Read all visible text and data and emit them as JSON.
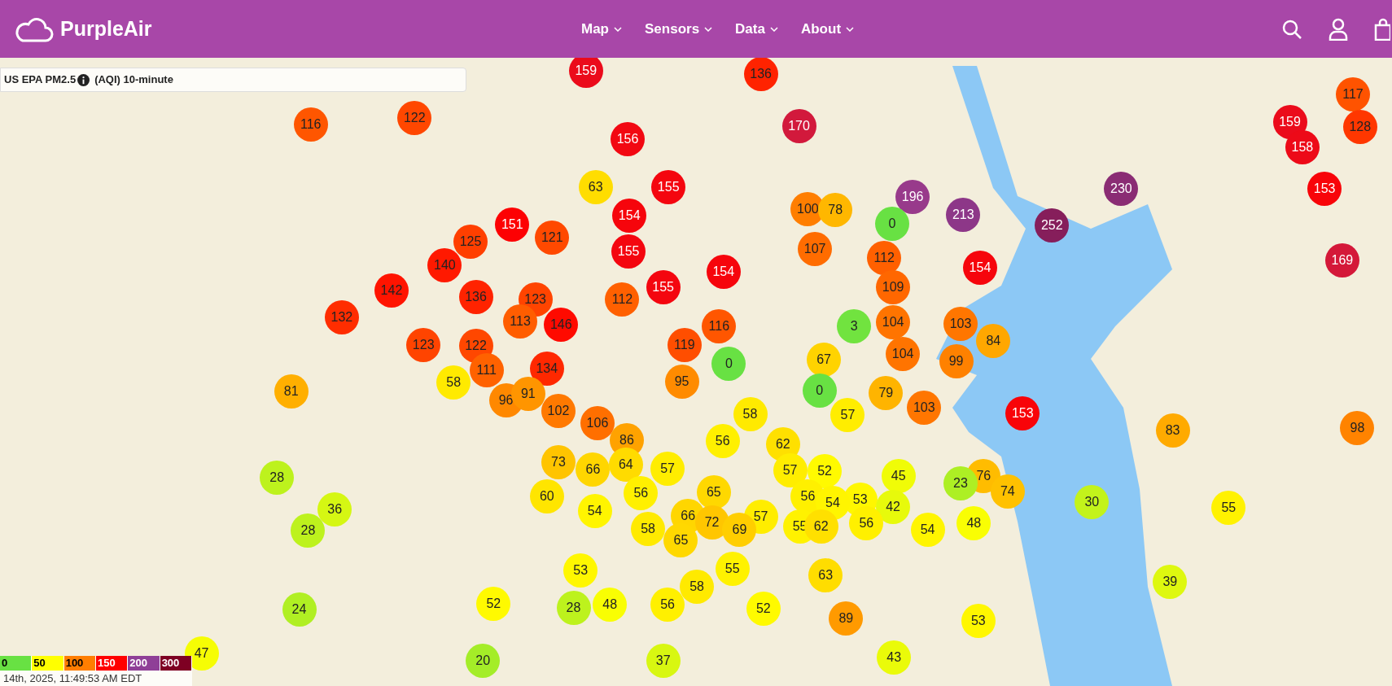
{
  "header": {
    "brand": "PurpleAir",
    "nav": [
      {
        "label": "Map"
      },
      {
        "label": "Sensors"
      },
      {
        "label": "Data"
      },
      {
        "label": "About"
      }
    ]
  },
  "map_layer": {
    "label": "US EPA PM2.5",
    "suffix": "(AQI) 10-minute"
  },
  "markers": [
    {
      "value": "159"
    },
    {
      "value": "136"
    },
    {
      "value": "117"
    },
    {
      "value": "116"
    },
    {
      "value": "122"
    },
    {
      "value": "156"
    },
    {
      "value": "170"
    },
    {
      "value": "159"
    },
    {
      "value": "158"
    },
    {
      "value": "128"
    },
    {
      "value": "63"
    },
    {
      "value": "155"
    },
    {
      "value": "196"
    },
    {
      "value": "230"
    },
    {
      "value": "153"
    },
    {
      "value": "151"
    },
    {
      "value": "154"
    },
    {
      "value": "100"
    },
    {
      "value": "78"
    },
    {
      "value": "0"
    },
    {
      "value": "213"
    },
    {
      "value": "252"
    },
    {
      "value": "125"
    },
    {
      "value": "121"
    },
    {
      "value": "155"
    },
    {
      "value": "107"
    },
    {
      "value": "140"
    },
    {
      "value": "154"
    },
    {
      "value": "112"
    },
    {
      "value": "154"
    },
    {
      "value": "169"
    },
    {
      "value": "142"
    },
    {
      "value": "136"
    },
    {
      "value": "123"
    },
    {
      "value": "112"
    },
    {
      "value": "155"
    },
    {
      "value": "109"
    },
    {
      "value": "132"
    },
    {
      "value": "113"
    },
    {
      "value": "146"
    },
    {
      "value": "116"
    },
    {
      "value": "3"
    },
    {
      "value": "104"
    },
    {
      "value": "103"
    },
    {
      "value": "123"
    },
    {
      "value": "122"
    },
    {
      "value": "119"
    },
    {
      "value": "104"
    },
    {
      "value": "84"
    },
    {
      "value": "111"
    },
    {
      "value": "134"
    },
    {
      "value": "0"
    },
    {
      "value": "67"
    },
    {
      "value": "99"
    },
    {
      "value": "81"
    },
    {
      "value": "58"
    },
    {
      "value": "96"
    },
    {
      "value": "91"
    },
    {
      "value": "102"
    },
    {
      "value": "106"
    },
    {
      "value": "86"
    },
    {
      "value": "95"
    },
    {
      "value": "56"
    },
    {
      "value": "58"
    },
    {
      "value": "0"
    },
    {
      "value": "57"
    },
    {
      "value": "79"
    },
    {
      "value": "103"
    },
    {
      "value": "153"
    },
    {
      "value": "83"
    },
    {
      "value": "98"
    },
    {
      "value": "73"
    },
    {
      "value": "62"
    },
    {
      "value": "28"
    },
    {
      "value": "66"
    },
    {
      "value": "64"
    },
    {
      "value": "57"
    },
    {
      "value": "57"
    },
    {
      "value": "52"
    },
    {
      "value": "45"
    },
    {
      "value": "76"
    },
    {
      "value": "60"
    },
    {
      "value": "56"
    },
    {
      "value": "65"
    },
    {
      "value": "56"
    },
    {
      "value": "53"
    },
    {
      "value": "23"
    },
    {
      "value": "74"
    },
    {
      "value": "36"
    },
    {
      "value": "54"
    },
    {
      "value": "66"
    },
    {
      "value": "57"
    },
    {
      "value": "54"
    },
    {
      "value": "42"
    },
    {
      "value": "30"
    },
    {
      "value": "55"
    },
    {
      "value": "28"
    },
    {
      "value": "58"
    },
    {
      "value": "65"
    },
    {
      "value": "72"
    },
    {
      "value": "69"
    },
    {
      "value": "55"
    },
    {
      "value": "62"
    },
    {
      "value": "56"
    },
    {
      "value": "54"
    },
    {
      "value": "48"
    },
    {
      "value": "53"
    },
    {
      "value": "58"
    },
    {
      "value": "55"
    },
    {
      "value": "63"
    },
    {
      "value": "39"
    },
    {
      "value": "24"
    },
    {
      "value": "52"
    },
    {
      "value": "28"
    },
    {
      "value": "48"
    },
    {
      "value": "56"
    },
    {
      "value": "52"
    },
    {
      "value": "89"
    },
    {
      "value": "53"
    },
    {
      "value": "47"
    },
    {
      "value": "20"
    },
    {
      "value": "37"
    },
    {
      "value": "43"
    }
  ],
  "legend": {
    "stops": [
      {
        "label": "0"
      },
      {
        "label": "50"
      },
      {
        "label": "100"
      },
      {
        "label": "150"
      },
      {
        "label": "200"
      },
      {
        "label": "300"
      }
    ]
  },
  "timestamp": "14th, 2025, 11:49:53 AM EDT"
}
